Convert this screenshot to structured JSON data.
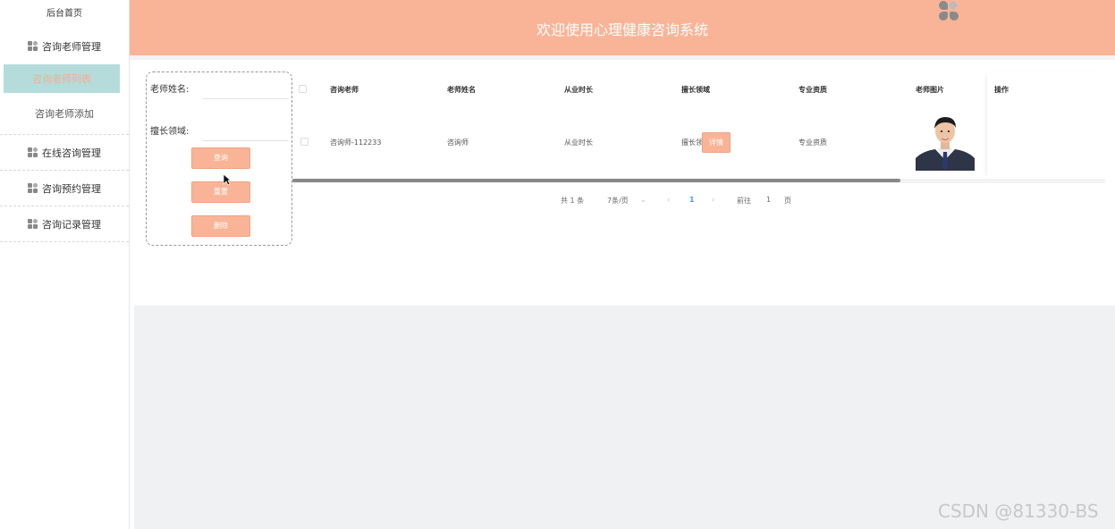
{
  "sidebar": {
    "home": "后台首页",
    "groups": [
      {
        "label": "咨询老师管理",
        "children": [
          {
            "label": "咨询老师列表",
            "active": true
          },
          {
            "label": "咨询老师添加",
            "active": false
          }
        ]
      },
      {
        "label": "在线咨询管理"
      },
      {
        "label": "咨询预约管理"
      },
      {
        "label": "咨询记录管理"
      }
    ]
  },
  "header": {
    "title": "欢迎使用心理健康咨询系统",
    "logo_icon": "clover-logo-icon"
  },
  "search": {
    "fields": [
      {
        "label": "老师姓名:",
        "value": "",
        "placeholder": ""
      },
      {
        "label": "擅长领域:",
        "value": "",
        "placeholder": ""
      }
    ],
    "buttons": [
      "查询",
      "重置",
      "删除"
    ]
  },
  "table": {
    "columns": [
      "咨询老师",
      "老师姓名",
      "从业时长",
      "擅长领域",
      "专业资质",
      "老师图片",
      "操作"
    ],
    "rows": [
      {
        "consultant": "咨询师-112233",
        "name": "咨询师",
        "experience": "从业时长",
        "field": "擅长领域",
        "qualification": "专业资质",
        "photo": "teacher-portrait",
        "action": "详情"
      }
    ]
  },
  "pagination": {
    "total": "共 1 条",
    "page_size": "7条/页",
    "current_page": "1",
    "goto_prefix": "前往",
    "goto_value": "1",
    "goto_suffix": "页"
  },
  "colors": {
    "accent": "#f9b497",
    "active_menu_bg": "#b5dbdb",
    "active_menu_text": "#f6ad8f"
  },
  "watermark": "CSDN @81330-BS"
}
